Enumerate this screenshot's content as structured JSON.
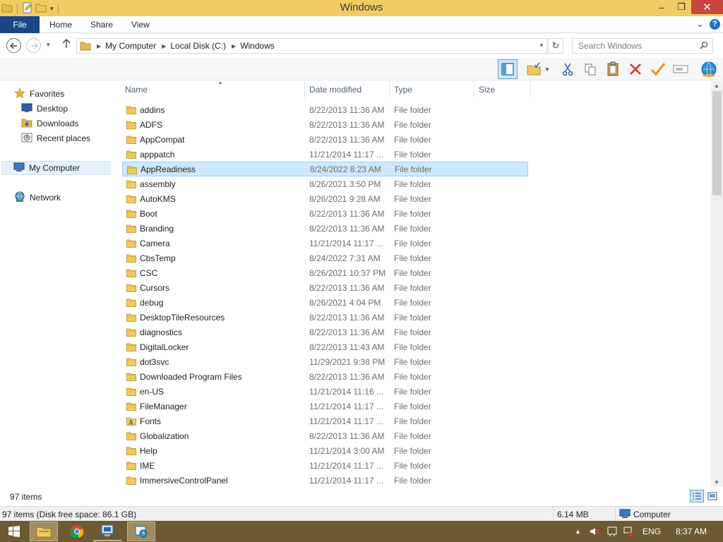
{
  "window": {
    "title": "Windows",
    "min": "–",
    "max": "❐",
    "close": "✕"
  },
  "ribbon": {
    "file": "File",
    "tabs": [
      "Home",
      "Share",
      "View"
    ],
    "expand": "⌄",
    "help": "?"
  },
  "address": {
    "crumbs": [
      "My Computer",
      "Local Disk (C:)",
      "Windows"
    ],
    "search_placeholder": "Search Windows"
  },
  "nav": {
    "favorites": "Favorites",
    "desktop": "Desktop",
    "downloads": "Downloads",
    "recent": "Recent places",
    "computer": "My Computer",
    "network": "Network"
  },
  "columns": {
    "name": "Name",
    "date": "Date modified",
    "type": "Type",
    "size": "Size"
  },
  "files": [
    {
      "name": "addins",
      "date": "8/22/2013 11:36 AM",
      "type": "File folder"
    },
    {
      "name": "ADFS",
      "date": "8/22/2013 11:36 AM",
      "type": "File folder"
    },
    {
      "name": "AppCompat",
      "date": "8/22/2013 11:36 AM",
      "type": "File folder"
    },
    {
      "name": "apppatch",
      "date": "11/21/2014 11:17 ...",
      "type": "File folder"
    },
    {
      "name": "AppReadiness",
      "date": "8/24/2022 8:23 AM",
      "type": "File folder",
      "selected": true
    },
    {
      "name": "assembly",
      "date": "8/26/2021 3:50 PM",
      "type": "File folder"
    },
    {
      "name": "AutoKMS",
      "date": "8/26/2021 9:28 AM",
      "type": "File folder"
    },
    {
      "name": "Boot",
      "date": "8/22/2013 11:36 AM",
      "type": "File folder"
    },
    {
      "name": "Branding",
      "date": "8/22/2013 11:36 AM",
      "type": "File folder"
    },
    {
      "name": "Camera",
      "date": "11/21/2014 11:17 ...",
      "type": "File folder"
    },
    {
      "name": "CbsTemp",
      "date": "8/24/2022 7:31 AM",
      "type": "File folder"
    },
    {
      "name": "CSC",
      "date": "8/26/2021 10:37 PM",
      "type": "File folder"
    },
    {
      "name": "Cursors",
      "date": "8/22/2013 11:36 AM",
      "type": "File folder"
    },
    {
      "name": "debug",
      "date": "8/26/2021 4:04 PM",
      "type": "File folder"
    },
    {
      "name": "DesktopTileResources",
      "date": "8/22/2013 11:36 AM",
      "type": "File folder"
    },
    {
      "name": "diagnostics",
      "date": "8/22/2013 11:36 AM",
      "type": "File folder"
    },
    {
      "name": "DigitalLocker",
      "date": "8/22/2013 11:43 AM",
      "type": "File folder"
    },
    {
      "name": "dot3svc",
      "date": "11/29/2021 9:38 PM",
      "type": "File folder"
    },
    {
      "name": "Downloaded Program Files",
      "date": "8/22/2013 11:36 AM",
      "type": "File folder"
    },
    {
      "name": "en-US",
      "date": "11/21/2014 11:16 ...",
      "type": "File folder"
    },
    {
      "name": "FileManager",
      "date": "11/21/2014 11:17 ...",
      "type": "File folder"
    },
    {
      "name": "Fonts",
      "date": "11/21/2014 11:17 ...",
      "type": "File folder",
      "icon": "fonts-folder-icon"
    },
    {
      "name": "Globalization",
      "date": "8/22/2013 11:36 AM",
      "type": "File folder"
    },
    {
      "name": "Help",
      "date": "11/21/2014 3:00 AM",
      "type": "File folder"
    },
    {
      "name": "IME",
      "date": "11/21/2014 11:17 ...",
      "type": "File folder"
    },
    {
      "name": "ImmersiveControlPanel",
      "date": "11/21/2014 11:17 ...",
      "type": "File folder"
    }
  ],
  "footer": {
    "item_count": "97 items"
  },
  "status": {
    "left": "97 items (Disk free space: 86.1 GB)",
    "size": "6.14 MB",
    "location": "Computer"
  },
  "taskbar": {
    "lang": "ENG",
    "time": "8:37 AM"
  },
  "colors": {
    "titlebar": "#f1cc62",
    "file_tab": "#19478a",
    "selection": "#cde8ff",
    "taskbar": "#6b5a33",
    "close": "#c7463b"
  }
}
